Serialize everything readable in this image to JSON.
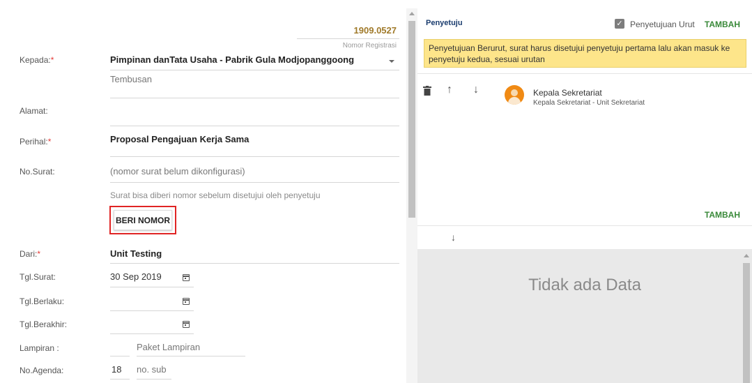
{
  "form": {
    "registration_number": "1909.0527",
    "registration_label": "Nomor Registrasi",
    "kepada": {
      "label": "Kepada:",
      "required_mark": "*",
      "value": "Pimpinan danTata Usaha - Pabrik Gula Modjopanggoong"
    },
    "tembusan": {
      "placeholder": "Tembusan"
    },
    "alamat": {
      "label": "Alamat:"
    },
    "perihal": {
      "label": "Perihal:",
      "required_mark": "*",
      "value": "Proposal Pengajuan Kerja Sama"
    },
    "no_surat": {
      "label": "No.Surat:",
      "value": "(nomor surat belum dikonfigurasi)",
      "hint": "Surat bisa diberi nomor sebelum disetujui oleh penyetuju"
    },
    "beri_nomor_button": "BERI NOMOR",
    "dari": {
      "label": "Dari:",
      "required_mark": "*",
      "value": "Unit Testing"
    },
    "tgl_surat": {
      "label": "Tgl.Surat:",
      "value": "30 Sep 2019"
    },
    "tgl_berlaku": {
      "label": "Tgl.Berlaku:",
      "value": ""
    },
    "tgl_berakhir": {
      "label": "Tgl.Berakhir:",
      "value": ""
    },
    "lampiran": {
      "label": "Lampiran :",
      "placeholder": "Paket Lampiran"
    },
    "no_agenda": {
      "label": "No.Agenda:",
      "value": "18",
      "sub_placeholder": "no. sub"
    }
  },
  "approvers": {
    "title": "Penyetuju",
    "sequential_label": "Penyetujuan Urut",
    "sequential_checked": true,
    "add_label": "TAMBAH",
    "info_text": "Penyetujuan Berurut, surat harus disetujui penyetuju pertama lalu akan masuk ke penyetuju kedua, sesuai urutan",
    "items": [
      {
        "name": "Kepala Sekretariat",
        "subtitle": "Kepala Sekretariat - Unit Sekretariat",
        "icon": "user-avatar"
      }
    ],
    "add_label_bottom": "TAMBAH",
    "empty_text": "Tidak ada Data"
  },
  "colors": {
    "registration": "#a07a2a",
    "required": "#e53935",
    "accent_green": "#3a8a3a",
    "info_bg": "#fde58a",
    "highlight_border": "#e02424",
    "title_blue": "#1a3c6e"
  }
}
